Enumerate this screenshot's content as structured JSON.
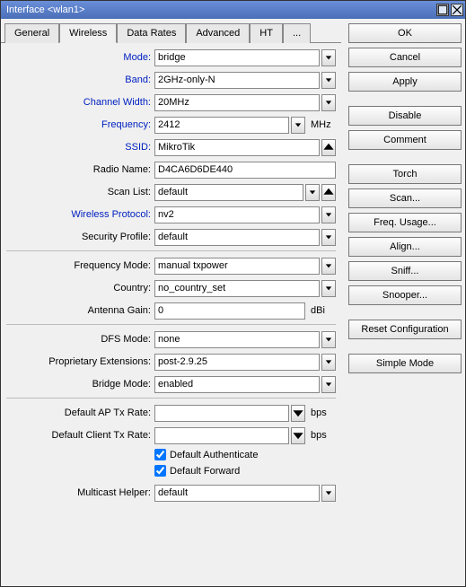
{
  "window": {
    "title": "Interface <wlan1>"
  },
  "tabs": [
    "General",
    "Wireless",
    "Data Rates",
    "Advanced",
    "HT",
    "..."
  ],
  "active_tab": 1,
  "fields": {
    "mode": {
      "label": "Mode:",
      "value": "bridge",
      "blue": true
    },
    "band": {
      "label": "Band:",
      "value": "2GHz-only-N",
      "blue": true
    },
    "chwidth": {
      "label": "Channel Width:",
      "value": "20MHz",
      "blue": true
    },
    "freq": {
      "label": "Frequency:",
      "value": "2412",
      "blue": true,
      "unit": "MHz"
    },
    "ssid": {
      "label": "SSID:",
      "value": "MikroTik",
      "blue": true
    },
    "radioname": {
      "label": "Radio Name:",
      "value": "D4CA6D6DE440"
    },
    "scanlist": {
      "label": "Scan List:",
      "value": "default"
    },
    "wproto": {
      "label": "Wireless Protocol:",
      "value": "nv2",
      "blue": true
    },
    "secprof": {
      "label": "Security Profile:",
      "value": "default"
    },
    "freqmode": {
      "label": "Frequency Mode:",
      "value": "manual txpower"
    },
    "country": {
      "label": "Country:",
      "value": "no_country_set"
    },
    "antgain": {
      "label": "Antenna Gain:",
      "value": "0",
      "unit": "dBi"
    },
    "dfsmode": {
      "label": "DFS Mode:",
      "value": "none"
    },
    "propext": {
      "label": "Proprietary Extensions:",
      "value": "post-2.9.25"
    },
    "bridgemode": {
      "label": "Bridge Mode:",
      "value": "enabled"
    },
    "defaptx": {
      "label": "Default AP Tx Rate:",
      "value": "",
      "unit": "bps"
    },
    "defcltx": {
      "label": "Default Client Tx Rate:",
      "value": "",
      "unit": "bps"
    },
    "defauth": {
      "label": "Default Authenticate",
      "checked": true
    },
    "deffwd": {
      "label": "Default Forward",
      "checked": true
    },
    "mcasthelper": {
      "label": "Multicast Helper:",
      "value": "default"
    }
  },
  "buttons": {
    "ok": "OK",
    "cancel": "Cancel",
    "apply": "Apply",
    "disable": "Disable",
    "comment": "Comment",
    "torch": "Torch",
    "scan": "Scan...",
    "frequsage": "Freq. Usage...",
    "align": "Align...",
    "sniff": "Sniff...",
    "snooper": "Snooper...",
    "resetcfg": "Reset Configuration",
    "simplemode": "Simple Mode"
  },
  "button_groups": [
    [
      "ok",
      "cancel",
      "apply"
    ],
    [
      "disable",
      "comment"
    ],
    [
      "torch",
      "scan",
      "frequsage",
      "align",
      "sniff",
      "snooper"
    ],
    [
      "resetcfg"
    ],
    [
      "simplemode"
    ]
  ]
}
